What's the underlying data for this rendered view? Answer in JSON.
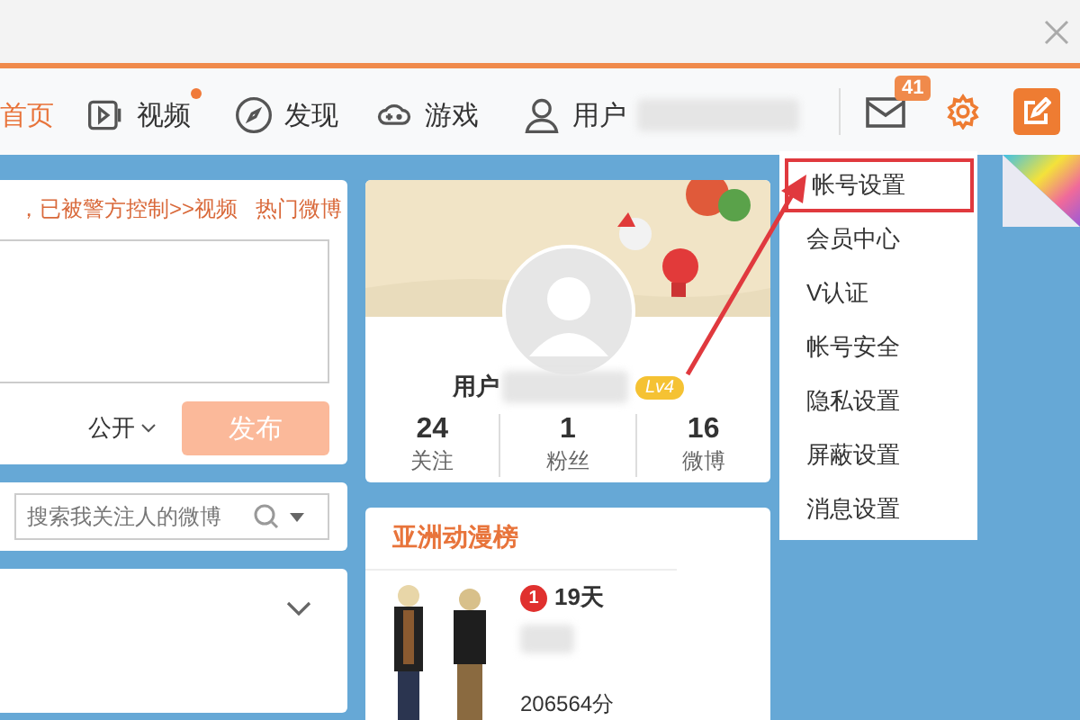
{
  "nav": {
    "items": [
      {
        "kind": "home",
        "label": "首页",
        "selected": true,
        "notification": false
      },
      {
        "kind": "video",
        "label": "视频",
        "selected": false,
        "notification": true
      },
      {
        "kind": "discover",
        "label": "发现",
        "selected": false,
        "notification": false
      },
      {
        "kind": "game",
        "label": "游戏",
        "selected": false,
        "notification": false
      },
      {
        "kind": "user",
        "label": "用户",
        "selected": false,
        "notification": false
      }
    ],
    "message_count": "41"
  },
  "post_box": {
    "notice": "，已被警方控制>>视频",
    "link": "热门微博",
    "visibility": "公开",
    "submit": "发布"
  },
  "search": {
    "placeholder": "搜索我关注人的微博"
  },
  "profile": {
    "name": "用户",
    "level": "Lv4",
    "stats": [
      {
        "value": "24",
        "label": "关注"
      },
      {
        "value": "1",
        "label": "粉丝"
      },
      {
        "value": "16",
        "label": "微博"
      }
    ]
  },
  "ranking": {
    "title": "亚洲动漫榜",
    "rank": "1",
    "days": "19天",
    "score": "206564分"
  },
  "settings_menu": {
    "items": [
      {
        "label": "帐号设置",
        "selected": true
      },
      {
        "label": "会员中心",
        "selected": false
      },
      {
        "label": "V认证",
        "selected": false
      },
      {
        "label": "帐号安全",
        "selected": false
      },
      {
        "label": "隐私设置",
        "selected": false
      },
      {
        "label": "屏蔽设置",
        "selected": false
      },
      {
        "label": "消息设置",
        "selected": false
      }
    ]
  }
}
